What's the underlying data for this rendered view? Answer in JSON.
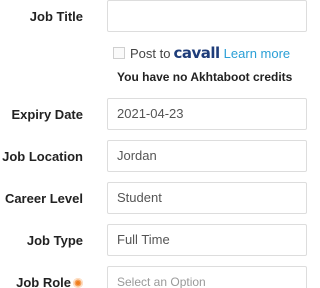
{
  "form": {
    "job_title": {
      "label": "Job Title",
      "value": ""
    },
    "post_to": {
      "prefix": "Post to",
      "brand": "cavall",
      "learn_more": "Learn more",
      "checked": false
    },
    "credits_notice": "You have no Akhtaboot credits",
    "expiry_date": {
      "label": "Expiry Date",
      "value": "2021-04-23"
    },
    "job_location": {
      "label": "Job Location",
      "value": "Jordan"
    },
    "career_level": {
      "label": "Career Level",
      "value": "Student"
    },
    "job_type": {
      "label": "Job Type",
      "value": "Full Time"
    },
    "job_role": {
      "label": "Job Role",
      "placeholder": "Select an Option",
      "required_icon": "required-dot-icon"
    }
  },
  "colors": {
    "brand": "#1f3d7a",
    "link": "#2a9fd6",
    "required": "#f5a25d"
  }
}
